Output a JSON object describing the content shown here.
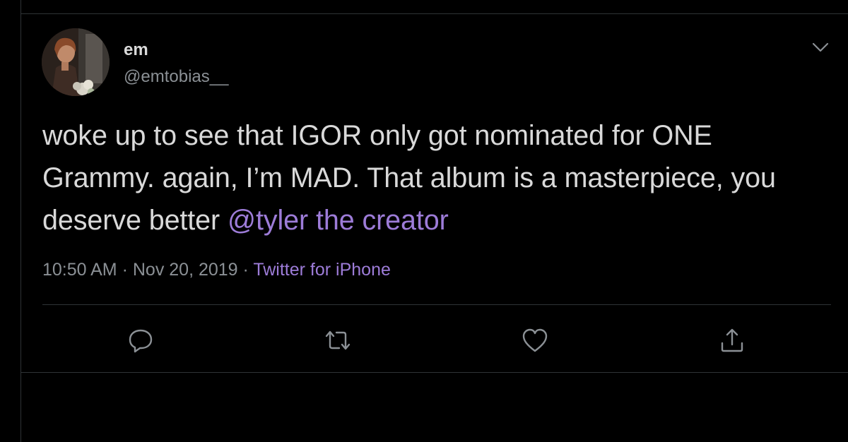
{
  "tweet": {
    "author_name": "em",
    "author_handle": "@emtobias__",
    "text_before_mention": "woke up to see that IGOR only got nominated for ONE Grammy. again, I’m MAD. That album is a masterpiece, you deserve better ",
    "mention": "@tyler the creator",
    "time": "10:50 AM",
    "separator_1": " · ",
    "date": "Nov 20, 2019",
    "separator_2": " · ",
    "source": "Twitter for iPhone"
  },
  "icons": {
    "menu": "chevron-down-icon",
    "reply": "reply-icon",
    "retweet": "retweet-icon",
    "like": "heart-icon",
    "share": "share-icon"
  },
  "colors": {
    "background": "#000000",
    "text": "#d9d9d9",
    "muted": "#8b9095",
    "accent": "#9d7cd8",
    "divider": "#2f3336"
  }
}
